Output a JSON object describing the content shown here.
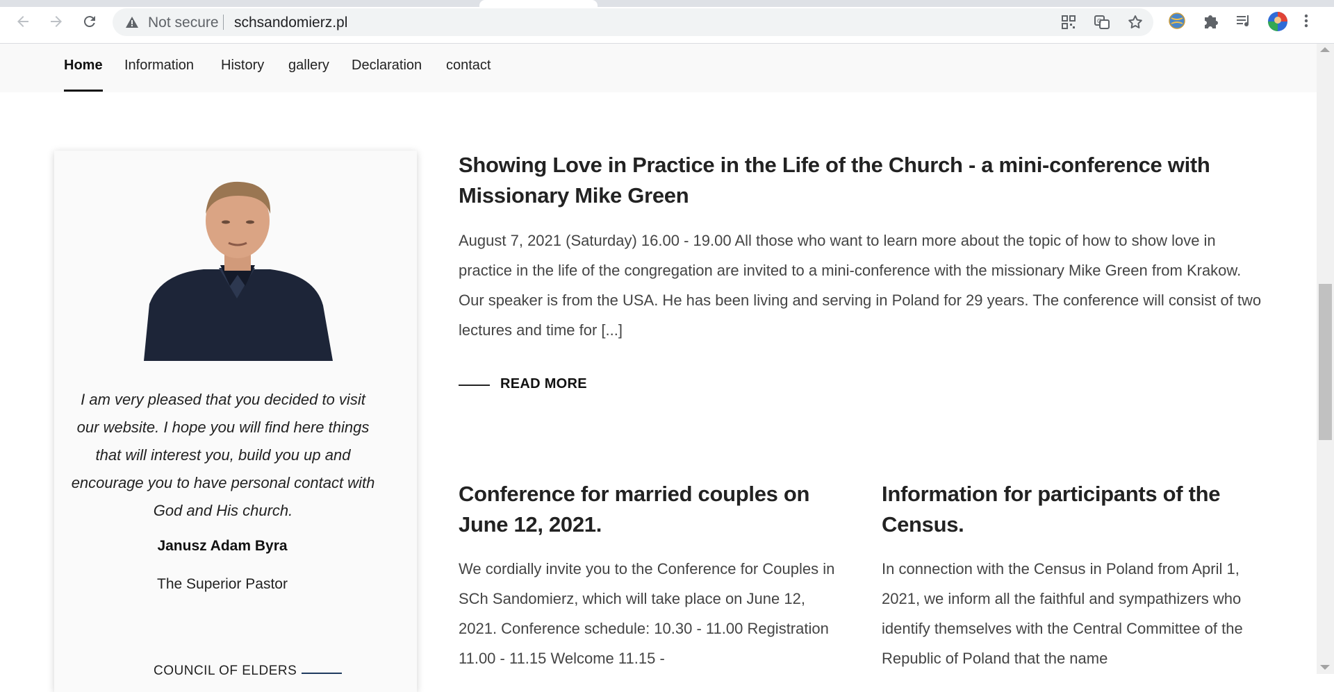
{
  "browser": {
    "security_label": "Not secure",
    "url": "schsandomierz.pl"
  },
  "nav": {
    "items": [
      "Home",
      "Information",
      "History",
      "gallery",
      "Declaration",
      "contact"
    ]
  },
  "sidebar": {
    "quote": "I am very pleased that you decided to visit our website. I hope you will find here things that will interest you, build you up and encourage you to have personal contact with God and His church.",
    "name": "Janusz Adam Byra",
    "role": "The Superior Pastor",
    "council_heading": "COUNCIL OF ELDERS"
  },
  "featured": {
    "title": "Showing Love in Practice in the Life of the Church - a mini-conference with Missionary Mike Green",
    "excerpt": "August 7, 2021 (Saturday) 16.00 - 19.00 All those who want to learn more about the topic of how to show love in practice in the life of the congregation are invited to a mini-conference with the missionary Mike Green from Krakow. Our speaker is from the USA. He has been living and serving in Poland for 29 years. The conference will consist of two lectures and time for [...]",
    "read_more": "READ MORE"
  },
  "articles": [
    {
      "title": "Conference for married couples on June 12, 2021.",
      "excerpt": "We cordially invite you to the Conference for Couples in SCh Sandomierz, which will take place on June 12, 2021. Conference schedule: 10.30 - 11.00 Registration 11.00 - 11.15 Welcome 11.15 -"
    },
    {
      "title": "Information for participants of the Census.",
      "excerpt": "In connection with the Census in Poland from April 1, 2021, we inform all the faithful and sympathizers who identify themselves with the Central Committee of the Republic of Poland that the name"
    }
  ]
}
